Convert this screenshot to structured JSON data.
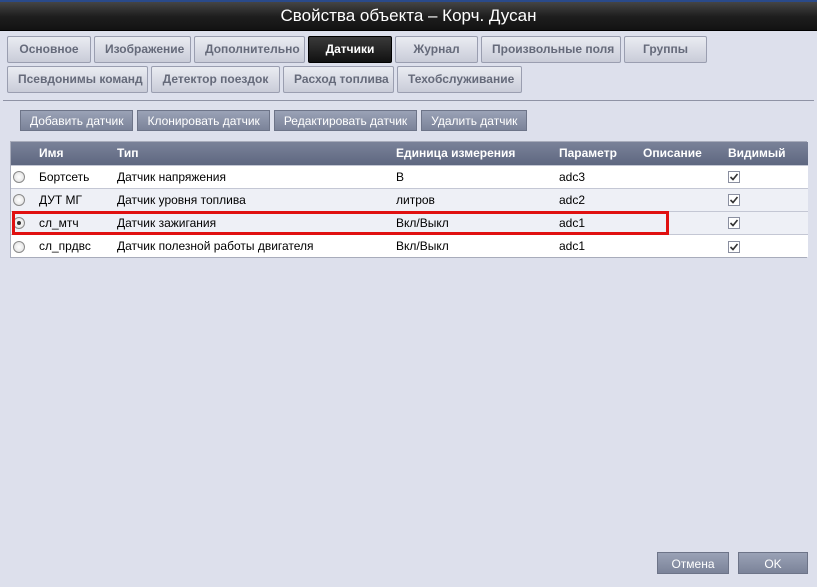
{
  "window": {
    "title": "Свойства объекта – Корч. Дусан"
  },
  "tabs": {
    "row1": [
      "Основное",
      "Изображение",
      "Дополнительно",
      "Датчики",
      "Журнал",
      "Произвольные поля",
      "Группы"
    ],
    "row2": [
      "Псевдонимы команд",
      "Детектор поездок",
      "Расход топлива",
      "Техобслуживание"
    ],
    "active": "Датчики"
  },
  "toolbar": {
    "add": "Добавить датчик",
    "clone": "Клонировать датчик",
    "edit": "Редактировать датчик",
    "delete": "Удалить датчик"
  },
  "table": {
    "columns": [
      "Имя",
      "Тип",
      "Единица измерения",
      "Параметр",
      "Описание",
      "Видимый"
    ],
    "rows": [
      {
        "name": "Бортсеть",
        "type": "Датчик напряжения",
        "unit": "В",
        "param": "adc3",
        "desc": "",
        "visible": true,
        "selected": false
      },
      {
        "name": "ДУТ МГ",
        "type": "Датчик уровня топлива",
        "unit": "литров",
        "param": "adc2",
        "desc": "",
        "visible": true,
        "selected": false
      },
      {
        "name": "сл_мтч",
        "type": "Датчик зажигания",
        "unit": "Вкл/Выкл",
        "param": "adc1",
        "desc": "",
        "visible": true,
        "selected": true
      },
      {
        "name": "сл_прдвс",
        "type": "Датчик полезной работы двигателя",
        "unit": "Вкл/Выкл",
        "param": "adc1",
        "desc": "",
        "visible": true,
        "selected": false
      }
    ]
  },
  "footer": {
    "cancel": "Отмена",
    "ok": "OK"
  },
  "colors": {
    "highlight": "#e01010",
    "active_tab": "#111111",
    "background": "#dde0ec"
  }
}
